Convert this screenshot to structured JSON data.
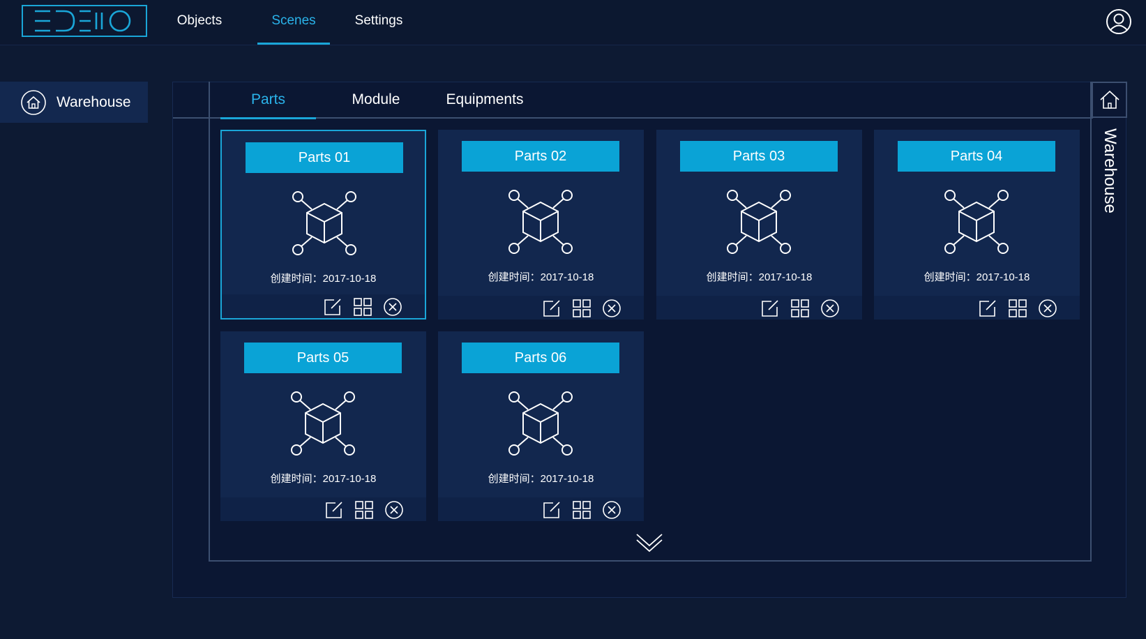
{
  "logo": {
    "text": "EDEMO"
  },
  "nav": {
    "items": [
      {
        "label": "Objects"
      },
      {
        "label": "Scenes"
      },
      {
        "label": "Settings"
      }
    ],
    "active": "Scenes"
  },
  "sidebar": {
    "items": [
      {
        "label": "Warehouse",
        "icon": "home-icon"
      }
    ]
  },
  "tabs": {
    "items": [
      {
        "label": "Parts"
      },
      {
        "label": "Module"
      },
      {
        "label": "Equipments"
      }
    ],
    "active": "Parts"
  },
  "panel": {
    "vertical_title": "Warehouse"
  },
  "cards": [
    {
      "title": "Parts 01",
      "date": "创建时间：2017-10-18"
    },
    {
      "title": "Parts 02",
      "date": "创建时间：2017-10-18"
    },
    {
      "title": "Parts 03",
      "date": "创建时间：2017-10-18"
    },
    {
      "title": "Parts 04",
      "date": "创建时间：2017-10-18"
    },
    {
      "title": "Parts 05",
      "date": "创建时间：2017-10-18"
    },
    {
      "title": "Parts 06",
      "date": "创建时间：2017-10-18"
    }
  ],
  "colors": {
    "accent": "#1aa6d8",
    "background": "#0d1a33",
    "card": "#12274e",
    "card_title": "#0aa3d6"
  }
}
